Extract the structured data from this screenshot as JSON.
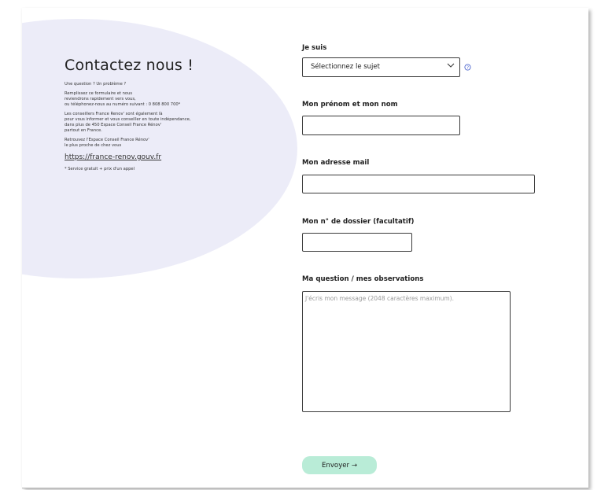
{
  "left_panel": {
    "title": "Contactez nous !",
    "p1": "Une question ? Un problème ?",
    "p2": "Remplissez ce formulaire et nous\nreviendrons rapidement vers vous,\nou téléphonez-nous au numéro suivant : 0 808 800 700*",
    "p3": "Les conseillers France Renov' sont également là\npour vous informer et vous conseiller en toute indépendance,\ndans plus de 450 Espace Conseil France Rénov'\npartout en France.",
    "p4": "Retrouvez l'Espace Conseil France Rénov'\nle plus proche de chez vous",
    "link": "https://france-renov.gouv.fr",
    "note": "* Service gratuit + prix d'un appel"
  },
  "form": {
    "je_suis_label": "Je suis",
    "subject_select_value": "Sélectionnez le sujet",
    "name_label": "Mon prénom et mon nom",
    "name_value": "",
    "email_label": "Mon adresse mail",
    "email_value": "",
    "dossier_label": "Mon n° de dossier (facultatif)",
    "dossier_value": "",
    "question_label": "Ma question / mes observations",
    "question_placeholder": "J'écris mon message (2048 caractères maximum).",
    "submit_label": "Envoyer →"
  },
  "colors": {
    "blob": "#ececf8",
    "submit_bg": "#b9ecd7",
    "help_icon": "#3d57c9"
  },
  "icons": {
    "select_chevron": "chevron-down-icon",
    "help": "help-icon"
  }
}
